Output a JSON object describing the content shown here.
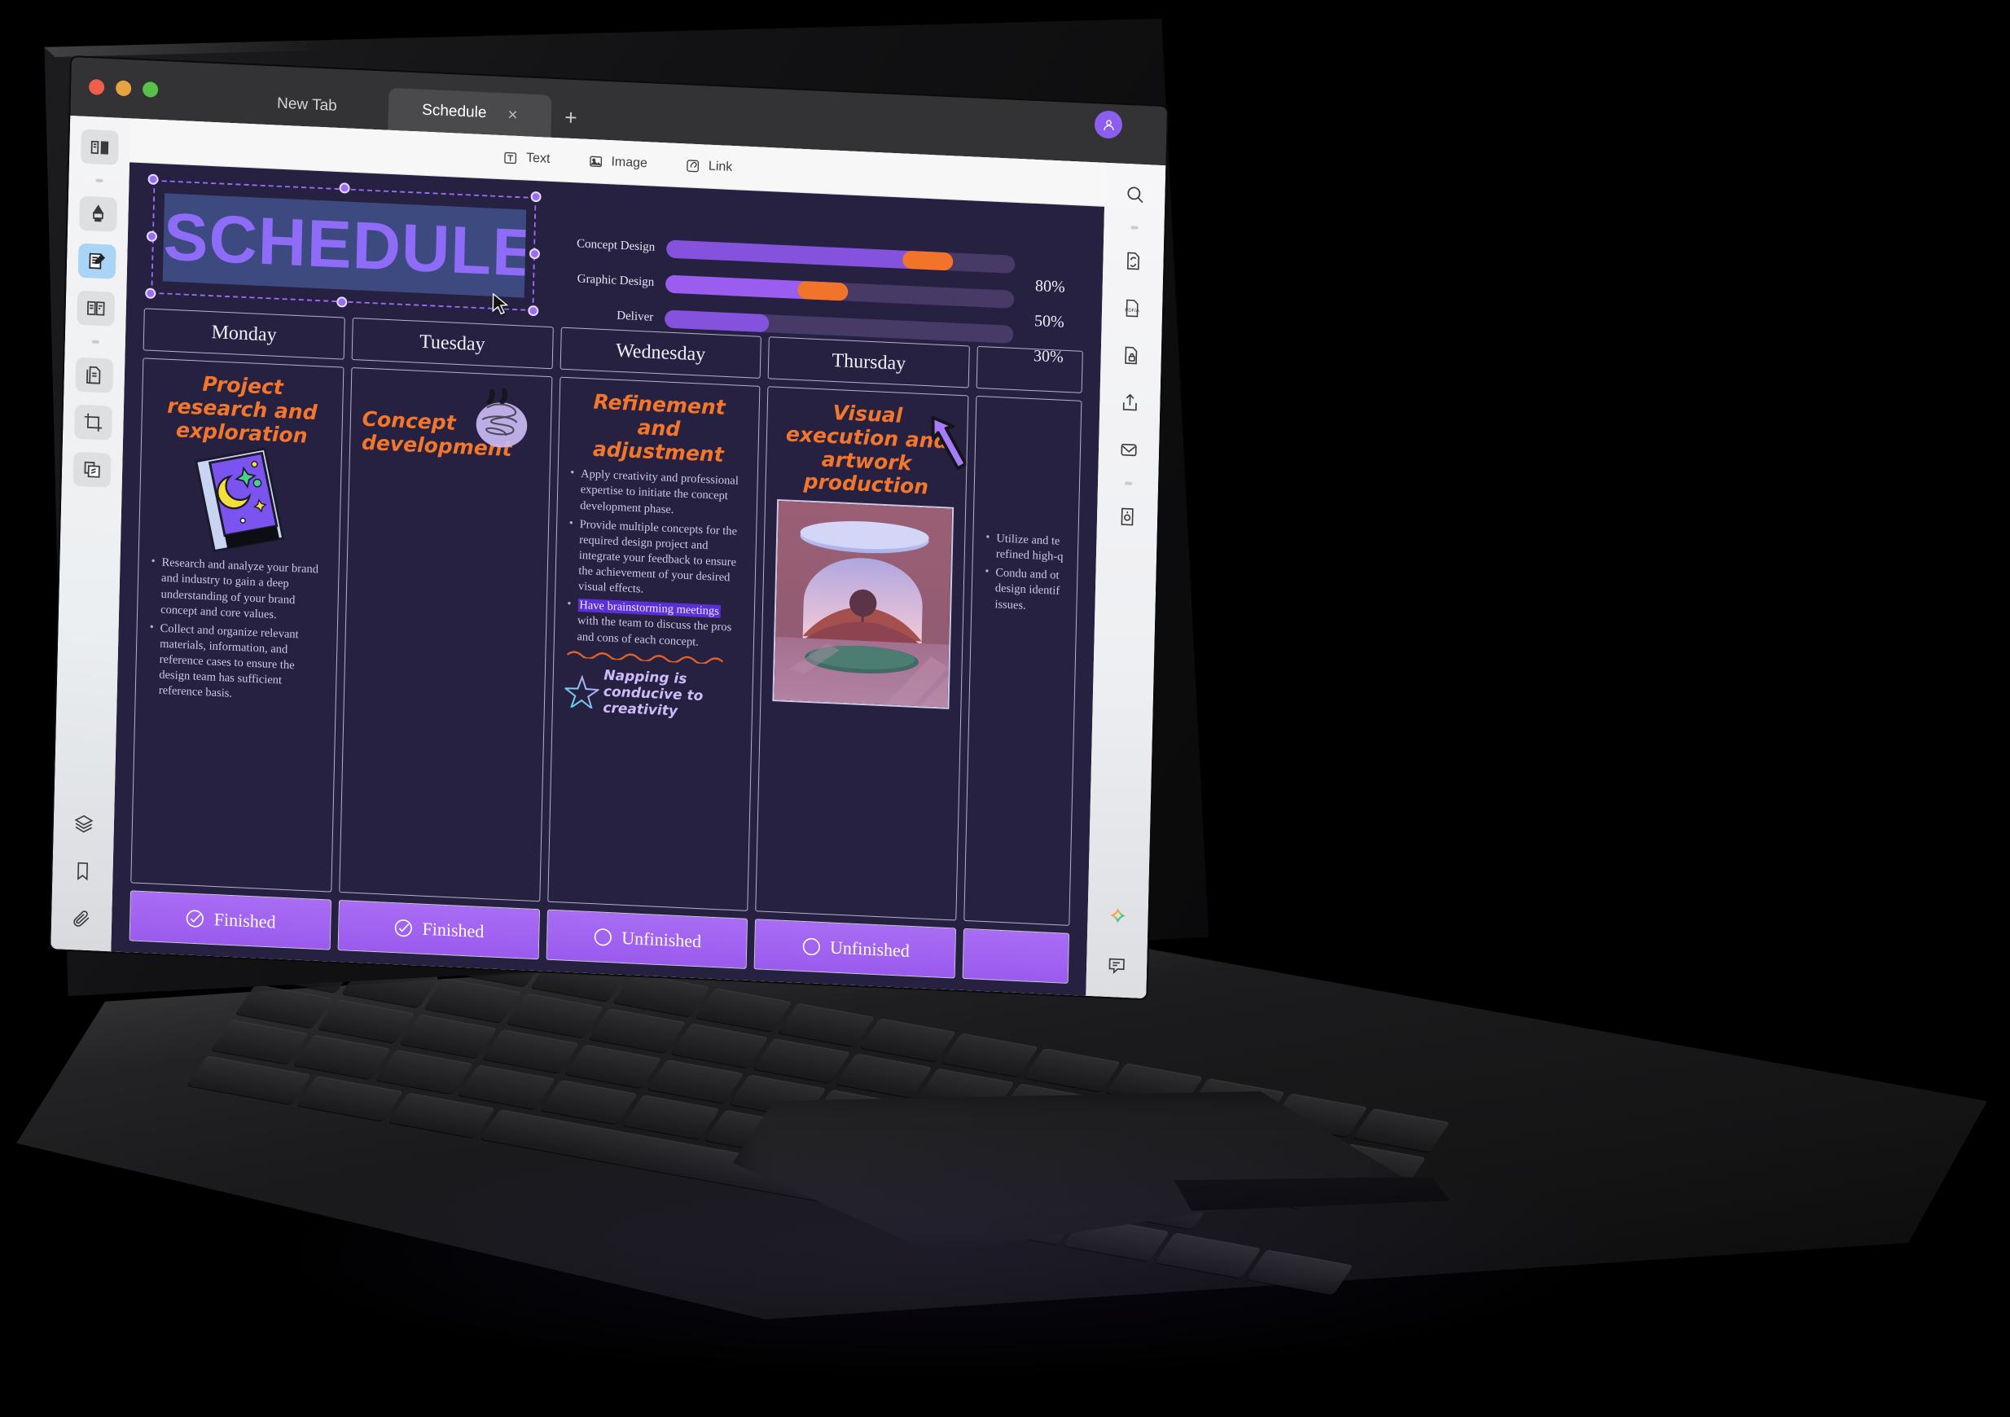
{
  "browser": {
    "traffic_lights": [
      "close",
      "minimize",
      "maximize"
    ],
    "tabs": [
      {
        "label": "New Tab",
        "active": false
      },
      {
        "label": "Schedule",
        "active": true
      }
    ],
    "close_tab_glyph": "×",
    "new_tab_glyph": "+",
    "avatar_icon": "user-avatar-icon"
  },
  "editor_toolbar": {
    "items": [
      {
        "label": "Text",
        "icon": "text-box-icon"
      },
      {
        "label": "Image",
        "icon": "image-icon"
      },
      {
        "label": "Link",
        "icon": "link-icon"
      }
    ]
  },
  "left_sidebar": {
    "items": [
      {
        "icon": "book-reader-icon",
        "active": false
      },
      {
        "icon": "highlighter-icon",
        "active": false
      },
      {
        "icon": "note-edit-icon",
        "active": true
      },
      {
        "icon": "open-book-icon",
        "active": false
      },
      {
        "icon": "documents-icon",
        "active": false
      },
      {
        "icon": "crop-icon",
        "active": false
      },
      {
        "icon": "stack-pages-icon",
        "active": false
      }
    ],
    "bottom_items": [
      {
        "icon": "layers-icon"
      },
      {
        "icon": "bookmark-icon"
      },
      {
        "icon": "paperclip-icon"
      }
    ]
  },
  "right_sidebar": {
    "items": [
      {
        "icon": "search-icon"
      },
      {
        "icon": "document-rotate-icon"
      },
      {
        "icon": "pdfa-icon"
      },
      {
        "icon": "document-lock-icon"
      },
      {
        "icon": "share-upload-icon"
      },
      {
        "icon": "mail-envelope-icon"
      },
      {
        "icon": "document-settings-icon"
      }
    ],
    "bottom_items": [
      {
        "icon": "ai-sparkle-icon"
      },
      {
        "icon": "comment-icon"
      }
    ]
  },
  "slide": {
    "title": "SCHEDULE",
    "title_selected": true,
    "selection_handles": 8,
    "cursor_icon": "mouse-pointer-icon",
    "progress": [
      {
        "label": "Concept Design",
        "percent": 80,
        "percent_label": "80%"
      },
      {
        "label": "Graphic Design",
        "percent": 50,
        "percent_label": "50%"
      },
      {
        "label": "Deliver",
        "percent": 30,
        "percent_label": "30%"
      }
    ],
    "days": [
      {
        "name": "Monday",
        "heading": "Project research and exploration",
        "sticker": "moon-book-sticker",
        "bullets": [
          "Research and analyze your brand and industry to gain a deep understanding of your brand concept and core values.",
          "Collect and organize relevant materials, information, and reference cases to ensure the design team has sufficient reference basis."
        ],
        "status": "Finished",
        "status_icon": "check-circle-icon"
      },
      {
        "name": "Tuesday",
        "heading": "Concept development",
        "sticker": "scribble-swirl-sticker",
        "bullets": [],
        "status": "Finished",
        "status_icon": "check-circle-icon"
      },
      {
        "name": "Wednesday",
        "heading": "Refinement and adjustment",
        "bullets": [
          "Apply creativity and professional expertise to initiate the concept development phase.",
          "Provide multiple concepts for the required design project and integrate your feedback to ensure the achievement of your desired visual effects.",
          "Have brainstorming meetings with the team to discuss the pros and cons of each concept."
        ],
        "highlight_phrase": "Have brainstorming meetings",
        "note": "Napping is conducive to creativity",
        "note_icon": "gradient-star-icon",
        "status": "Unfinished",
        "status_icon": "empty-circle-icon"
      },
      {
        "name": "Thursday",
        "heading": "Visual execution and artwork production",
        "sticker": "purple-arrow-sticker",
        "image": "surreal-landscape-illustration",
        "bullets": [],
        "status": "Unfinished",
        "status_icon": "empty-circle-icon"
      },
      {
        "name": "",
        "heading": "",
        "bullets": [
          "Utilize and te refined high-q",
          "Condu and ot design identif issues."
        ],
        "status": "",
        "status_icon": ""
      }
    ]
  },
  "colors": {
    "slide_bg": "#272141",
    "accent_orange": "#f2762c",
    "accent_purple": "#8f6cf8",
    "bar_track": "#473a66",
    "bar_fill": "#8552dd",
    "knob": "#f2732a",
    "status_bg": "#a96cf3",
    "highlight": "#5b2fd6"
  }
}
